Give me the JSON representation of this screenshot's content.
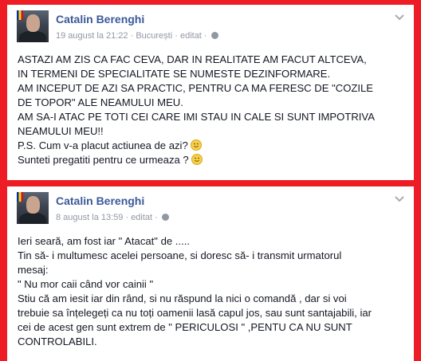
{
  "posts": [
    {
      "author": "Catalin Berenghi",
      "date": "19 august la 21:22",
      "location": "București",
      "edited": "editat",
      "lines": [
        "ASTAZI AM ZIS CA FAC CEVA, DAR IN REALITATE AM FACUT ALTCEVA,",
        "IN TERMENI DE SPECIALITATE SE NUMESTE DEZINFORMARE.",
        "AM INCEPUT DE AZI SA PRACTIC, PENTRU CA MA FERESC DE \"COZILE",
        "DE TOPOR\" ALE NEAMULUI MEU.",
        "AM SA-I ATAC PE TOTI CEI CARE IMI STAU IN CALE SI SUNT IMPOTRIVA",
        "NEAMULUI MEU!!",
        "P.S. Cum v-a placut actiunea de azi?",
        "Sunteti pregatiti pentru ce urmeaza ?"
      ]
    },
    {
      "author": "Catalin Berenghi",
      "date": "8 august la 13:59",
      "edited": "editat",
      "lines": [
        "Ieri seară, am fost iar \" Atacat\" de .....",
        "Tin să- i multumesc acelei persoane, si doresc să- i transmit urmatorul",
        "mesaj:",
        "\" Nu mor caii când vor cainii \"",
        "Stiu că am iesit iar din rând, si nu răspund la nici o comandă , dar si voi",
        "trebuie sa înțelegeți ca nu toți oamenii lasă capul jos, sau sunt santajabili, iar",
        "cei de acest gen sunt extrem de \" PERICULOSI \" ,PENTU CA NU SUNT",
        "CONTROLABILI."
      ]
    }
  ],
  "meta_separator": " · ",
  "icons": {
    "avatar": "profile-photo",
    "privacy": "globe-icon",
    "menu": "chevron-down-icon",
    "emoji": "smiley-icon"
  },
  "colors": {
    "background": "#ee1c24",
    "author": "#3b5998",
    "meta": "#9197a3",
    "text": "#141823"
  }
}
